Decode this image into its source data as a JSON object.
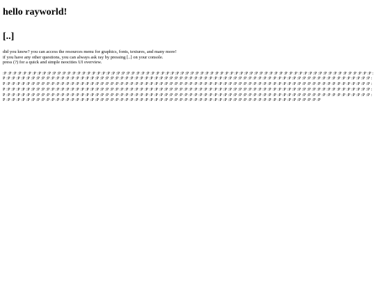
{
  "page": {
    "title": "hello rayworld!",
    "console_link": "[..]",
    "intro": {
      "line1": "did you know? you can access the resources menu for graphics, fonts, textures, and many more!",
      "line2_prefix": "if you have any other questions, you can always ask ray by pressing ",
      "line2_link": "[..]",
      "line2_suffix": " on your console.",
      "line3_prefix": "press ",
      "line3_link": "(?)",
      "line3_suffix": " for a quick and simple neocities UI overview."
    },
    "glyph_block": {
      "glyph": ":P",
      "count": 440
    }
  }
}
